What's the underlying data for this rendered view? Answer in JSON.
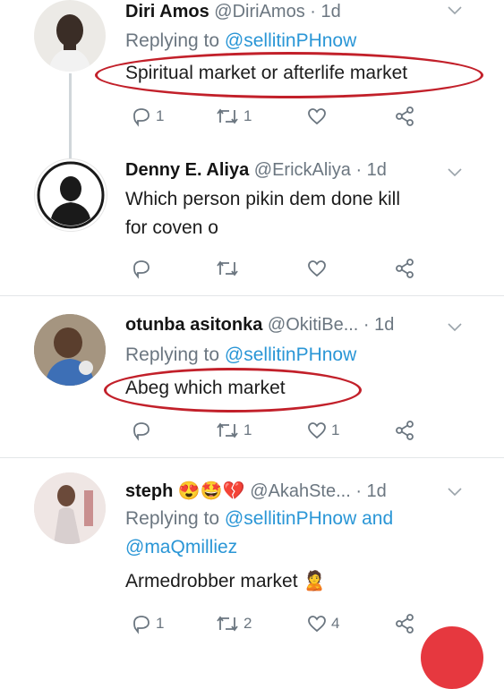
{
  "tweets": [
    {
      "name": "Diri Amos",
      "handle": "@DiriAmos",
      "time": "· 1d",
      "replying_label": "Replying to",
      "replying_to": "@sellitinPHnow",
      "text": "Spiritual market or afterlife market",
      "reply_count": "1",
      "retweet_count": "1",
      "like_count": ""
    },
    {
      "name": "Denny E. Aliya",
      "handle": "@ErickAliya",
      "time": "· 1d",
      "text_line1": "Which person pikin dem done kill",
      "text_line2": "for coven o",
      "reply_count": "",
      "retweet_count": "",
      "like_count": ""
    },
    {
      "name": "otunba asitonka",
      "handle": "@OkitiBe...",
      "time": "· 1d",
      "replying_label": "Replying to",
      "replying_to": "@sellitinPHnow",
      "text": "Abeg which market",
      "reply_count": "",
      "retweet_count": "1",
      "like_count": "1"
    },
    {
      "name": "steph",
      "emojis": "😍🤩💔",
      "handle": "@AkahSte...",
      "time": "· 1d",
      "replying_label": "Replying to",
      "replying_to": "@sellitinPHnow and",
      "replying_to_2": "@maQmilliez",
      "text": "Armedrobber market",
      "text_emoji": "🙎",
      "reply_count": "1",
      "retweet_count": "2",
      "like_count": "4"
    }
  ],
  "colors": {
    "link": "#2a96d6",
    "annotation": "#c2202a",
    "muted": "#6b7680"
  },
  "icons": [
    "reply-icon",
    "retweet-icon",
    "like-icon",
    "share-icon",
    "chevron-down-icon"
  ]
}
